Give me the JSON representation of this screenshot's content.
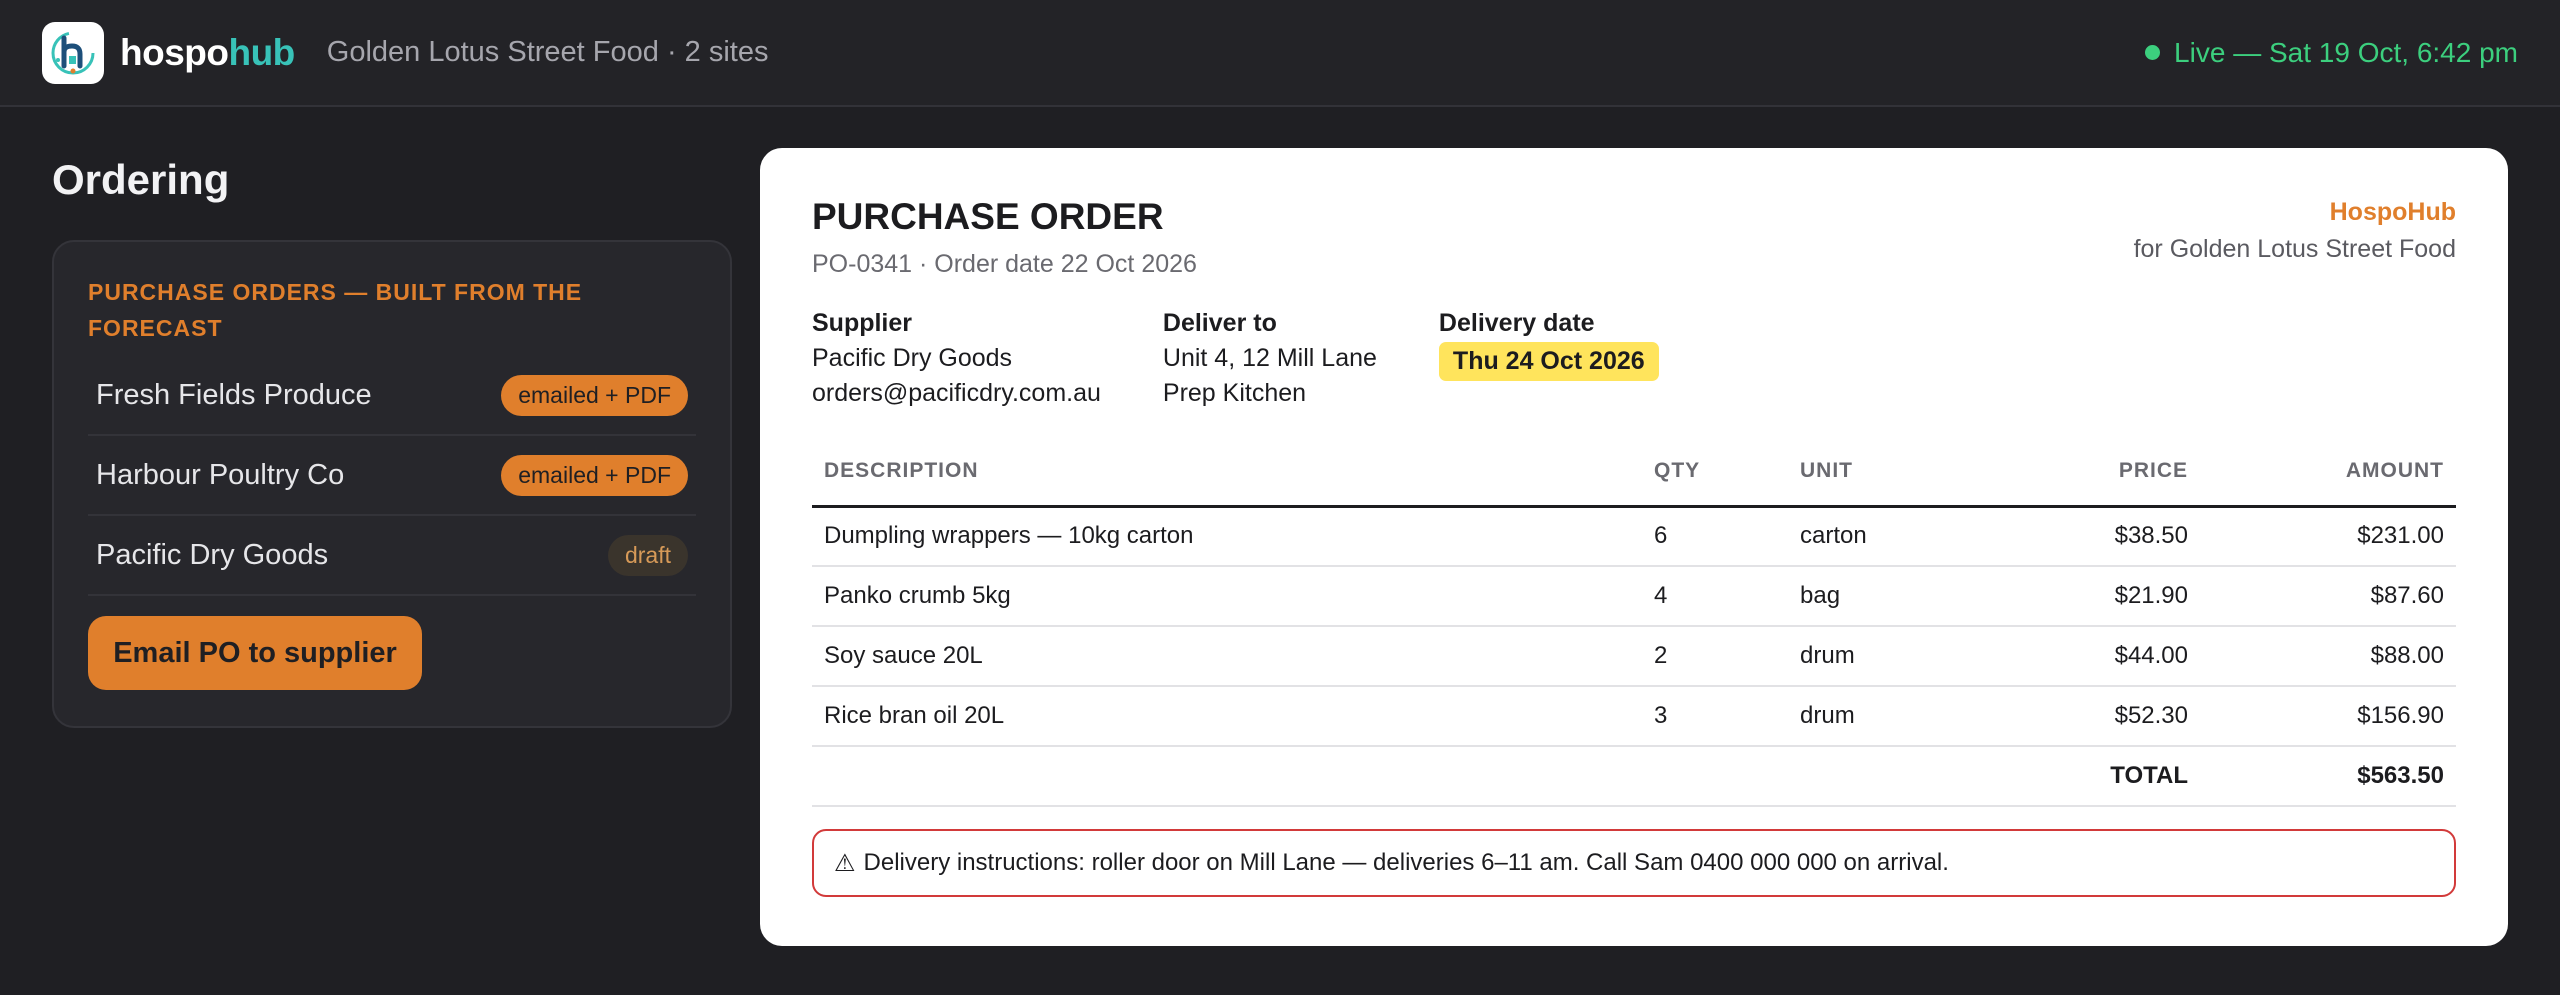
{
  "header": {
    "brand_part1": "hospo",
    "brand_part2": "hub",
    "tenant": "Golden Lotus Street Food · 2 sites",
    "live_status": "Live — Sat 19 Oct, 6:42 pm",
    "live_color": "#3ccf7e"
  },
  "sidebar": {
    "page_title": "Ordering",
    "panel_heading": "PURCHASE ORDERS — BUILT FROM THE FORECAST",
    "suppliers": [
      {
        "name": "Fresh Fields Produce",
        "status": "emailed + PDF"
      },
      {
        "name": "Harbour Poultry Co",
        "status": "emailed + PDF"
      },
      {
        "name": "Pacific Dry Goods",
        "status": "draft"
      }
    ],
    "email_button": "Email PO to supplier"
  },
  "po": {
    "title": "PURCHASE ORDER",
    "subtitle": "PO-0341 · Order date 22 Oct 2026",
    "brand_name": "HospoHub",
    "brand_for": "for Golden Lotus Street Food",
    "supplier_label": "Supplier",
    "supplier_name": "Pacific Dry Goods",
    "supplier_email": "orders@pacificdry.com.au",
    "deliver_label": "Deliver to",
    "deliver_line1": "Unit 4, 12 Mill Lane",
    "deliver_line2": "Prep Kitchen",
    "date_label": "Delivery date",
    "date_value": "Thu 24 Oct 2026",
    "columns": {
      "description": "DESCRIPTION",
      "qty": "QTY",
      "unit": "UNIT",
      "price": "PRICE",
      "amount": "AMOUNT"
    },
    "lines": [
      {
        "description": "Dumpling wrappers — 10kg carton",
        "qty": "6",
        "unit": "carton",
        "price": "$38.50",
        "amount": "$231.00"
      },
      {
        "description": "Panko crumb 5kg",
        "qty": "4",
        "unit": "bag",
        "price": "$21.90",
        "amount": "$87.60"
      },
      {
        "description": "Soy sauce 20L",
        "qty": "2",
        "unit": "drum",
        "price": "$44.00",
        "amount": "$88.00"
      },
      {
        "description": "Rice bran oil 20L",
        "qty": "3",
        "unit": "drum",
        "price": "$52.30",
        "amount": "$156.90"
      }
    ],
    "total_label": "TOTAL",
    "total_value": "$563.50",
    "notice_icon": "⚠",
    "notice": "Delivery instructions: roller door on Mill Lane — deliveries 6–11 am. Call Sam 0400 000 000 on arrival."
  },
  "colors": {
    "accent": "#e07f2c",
    "teal": "#38c2b8",
    "highlight": "#ffe45c",
    "warning": "#d23a3a"
  }
}
